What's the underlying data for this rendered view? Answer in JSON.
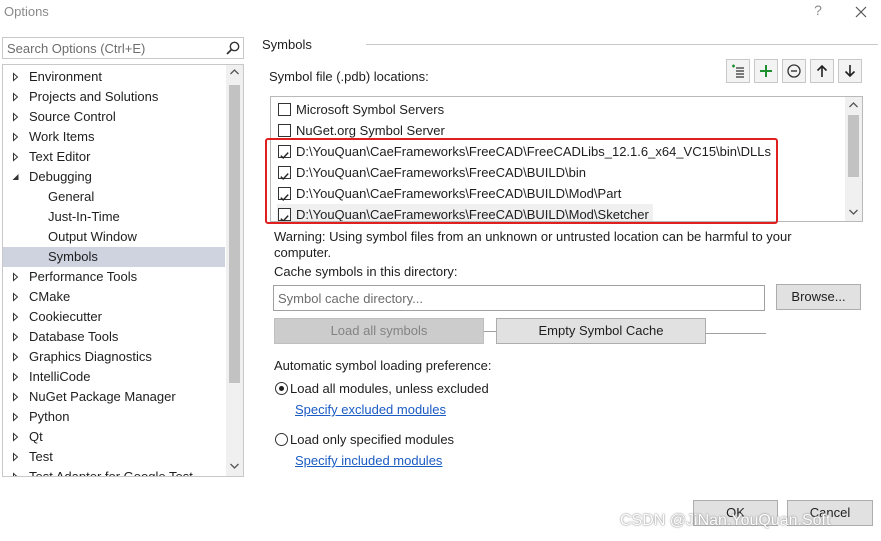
{
  "window": {
    "title": "Options",
    "help": "?"
  },
  "search": {
    "placeholder": "Search Options (Ctrl+E)"
  },
  "tree": {
    "items": [
      {
        "label": "Environment",
        "expandable": true,
        "expanded": false,
        "level": 0
      },
      {
        "label": "Projects and Solutions",
        "expandable": true,
        "expanded": false,
        "level": 0
      },
      {
        "label": "Source Control",
        "expandable": true,
        "expanded": false,
        "level": 0
      },
      {
        "label": "Work Items",
        "expandable": true,
        "expanded": false,
        "level": 0
      },
      {
        "label": "Text Editor",
        "expandable": true,
        "expanded": false,
        "level": 0
      },
      {
        "label": "Debugging",
        "expandable": true,
        "expanded": true,
        "level": 0
      },
      {
        "label": "General",
        "expandable": false,
        "level": 1
      },
      {
        "label": "Just-In-Time",
        "expandable": false,
        "level": 1
      },
      {
        "label": "Output Window",
        "expandable": false,
        "level": 1
      },
      {
        "label": "Symbols",
        "expandable": false,
        "level": 1,
        "selected": true
      },
      {
        "label": "Performance Tools",
        "expandable": true,
        "expanded": false,
        "level": 0
      },
      {
        "label": "CMake",
        "expandable": true,
        "expanded": false,
        "level": 0
      },
      {
        "label": "Cookiecutter",
        "expandable": true,
        "expanded": false,
        "level": 0
      },
      {
        "label": "Database Tools",
        "expandable": true,
        "expanded": false,
        "level": 0
      },
      {
        "label": "Graphics Diagnostics",
        "expandable": true,
        "expanded": false,
        "level": 0
      },
      {
        "label": "IntelliCode",
        "expandable": true,
        "expanded": false,
        "level": 0
      },
      {
        "label": "NuGet Package Manager",
        "expandable": true,
        "expanded": false,
        "level": 0
      },
      {
        "label": "Python",
        "expandable": true,
        "expanded": false,
        "level": 0
      },
      {
        "label": "Qt",
        "expandable": true,
        "expanded": false,
        "level": 0
      },
      {
        "label": "Test",
        "expandable": true,
        "expanded": false,
        "level": 0
      },
      {
        "label": "Test Adapter for Google Test",
        "expandable": true,
        "expanded": false,
        "level": 0
      }
    ]
  },
  "symbols": {
    "section_title": "Symbols",
    "pdb_label": "Symbol file (.pdb) locations:",
    "toolbar": [
      {
        "name": "add-path",
        "icon": "add-folder-icon"
      },
      {
        "name": "add",
        "icon": "plus-icon"
      },
      {
        "name": "remove",
        "icon": "minus-circle-icon"
      },
      {
        "name": "move-up",
        "icon": "arrow-up-icon"
      },
      {
        "name": "move-down",
        "icon": "arrow-down-icon"
      }
    ],
    "locations": [
      {
        "checked": false,
        "text": "Microsoft Symbol Servers"
      },
      {
        "checked": false,
        "text": "NuGet.org Symbol Server"
      },
      {
        "checked": true,
        "text": "D:\\YouQuan\\CaeFrameworks\\FreeCAD\\FreeCADLibs_12.1.6_x64_VC15\\bin\\DLLs"
      },
      {
        "checked": true,
        "text": "D:\\YouQuan\\CaeFrameworks\\FreeCAD\\BUILD\\bin"
      },
      {
        "checked": true,
        "text": "D:\\YouQuan\\CaeFrameworks\\FreeCAD\\BUILD\\Mod\\Part"
      },
      {
        "checked": true,
        "text": "D:\\YouQuan\\CaeFrameworks\\FreeCAD\\BUILD\\Mod\\Sketcher"
      }
    ],
    "warning": "Warning: Using symbol files from an unknown or untrusted location can be harmful to your computer.",
    "cache_label": "Cache symbols in this directory:",
    "cache_placeholder": "Symbol cache directory...",
    "browse_label": "Browse...",
    "load_all_label": "Load all symbols",
    "empty_cache_label": "Empty Symbol Cache",
    "auto_label": "Automatic symbol loading preference:",
    "radio_all": "Load all modules, unless excluded",
    "link_excluded": "Specify excluded modules",
    "radio_specified": "Load only specified modules",
    "link_included": "Specify included modules",
    "selected_option": "all"
  },
  "footer": {
    "ok_label": "OK",
    "cancel_label": "Cancel"
  },
  "watermark": "CSDN @JiNan.YouQuan.Soft",
  "colors": {
    "highlight_box": "#e02020",
    "selected_tree": "#cfd3df",
    "link": "#1a5bc4",
    "add_green": "#1e8f2e"
  }
}
